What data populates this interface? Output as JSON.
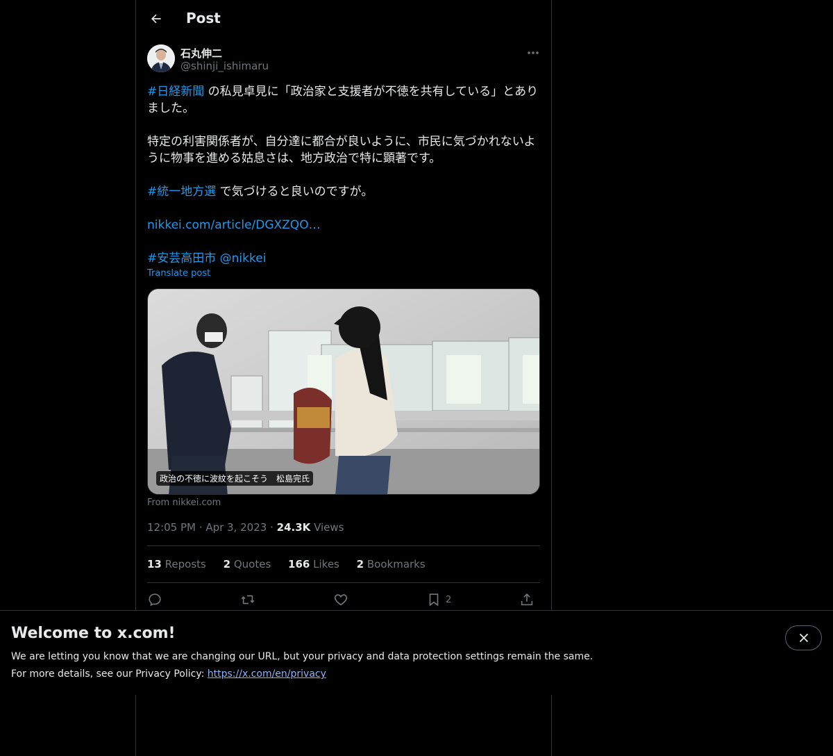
{
  "header": {
    "title": "Post"
  },
  "author": {
    "name": "石丸伸二",
    "handle": "@shinji_ishimaru"
  },
  "tweet": {
    "line1_tag": "#日経新聞",
    "line1_rest": " の私見卓見に「政治家と支援者が不徳を共有している」とあり",
    "line2": "ました。",
    "line3": "特定の利害関係者が、自分達に都合が良いように、市民に気づかれないよ",
    "line4": "うに物事を進める姑息さは、地方政治で特に顕著です。",
    "line5_tag": "#統一地方選",
    "line5_rest": " で気づけると良いのですが。",
    "url": "nikkei.com/article/DGXZQO…",
    "tag3": "#安芸高田市",
    "mention": "@nikkei",
    "translate": "Translate post"
  },
  "card": {
    "caption": "政治の不徳に波紋を起こそう　松島完氏",
    "source": "From nikkei.com"
  },
  "meta": {
    "time": "12:05 PM",
    "sep": "·",
    "date": "Apr 3, 2023",
    "views_count": "24.3K",
    "views_label": "Views"
  },
  "stats": [
    {
      "count": "13",
      "label": "Reposts"
    },
    {
      "count": "2",
      "label": "Quotes"
    },
    {
      "count": "166",
      "label": "Likes"
    },
    {
      "count": "2",
      "label": "Bookmarks"
    }
  ],
  "actions": {
    "bookmark_count": "2"
  },
  "banner": {
    "title": "Welcome to x.com!",
    "line1": "We are letting you know that we are changing our URL, but your privacy and data protection settings remain the same.",
    "line2_prefix": "For more details, see our Privacy Policy: ",
    "link": "https://x.com/en/privacy"
  },
  "colors": {
    "accent": "#1d9bf0",
    "background": "#000000",
    "border": "#2f3336",
    "muted": "#71767b"
  }
}
